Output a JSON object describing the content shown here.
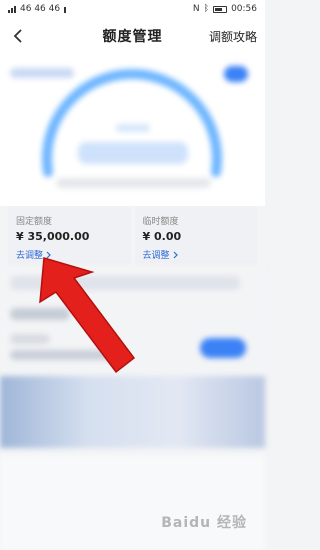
{
  "status_bar": {
    "left_text": "46 46 46",
    "time": "00:56"
  },
  "header": {
    "title": "额度管理",
    "strategy_label": "调额攻略"
  },
  "quotas": [
    {
      "label": "固定额度",
      "amount": "¥ 35,000.00",
      "link": "去调整"
    },
    {
      "label": "临时额度",
      "amount": "¥ 0.00",
      "link": "去调整"
    }
  ],
  "watermark": "Baidu 经验"
}
